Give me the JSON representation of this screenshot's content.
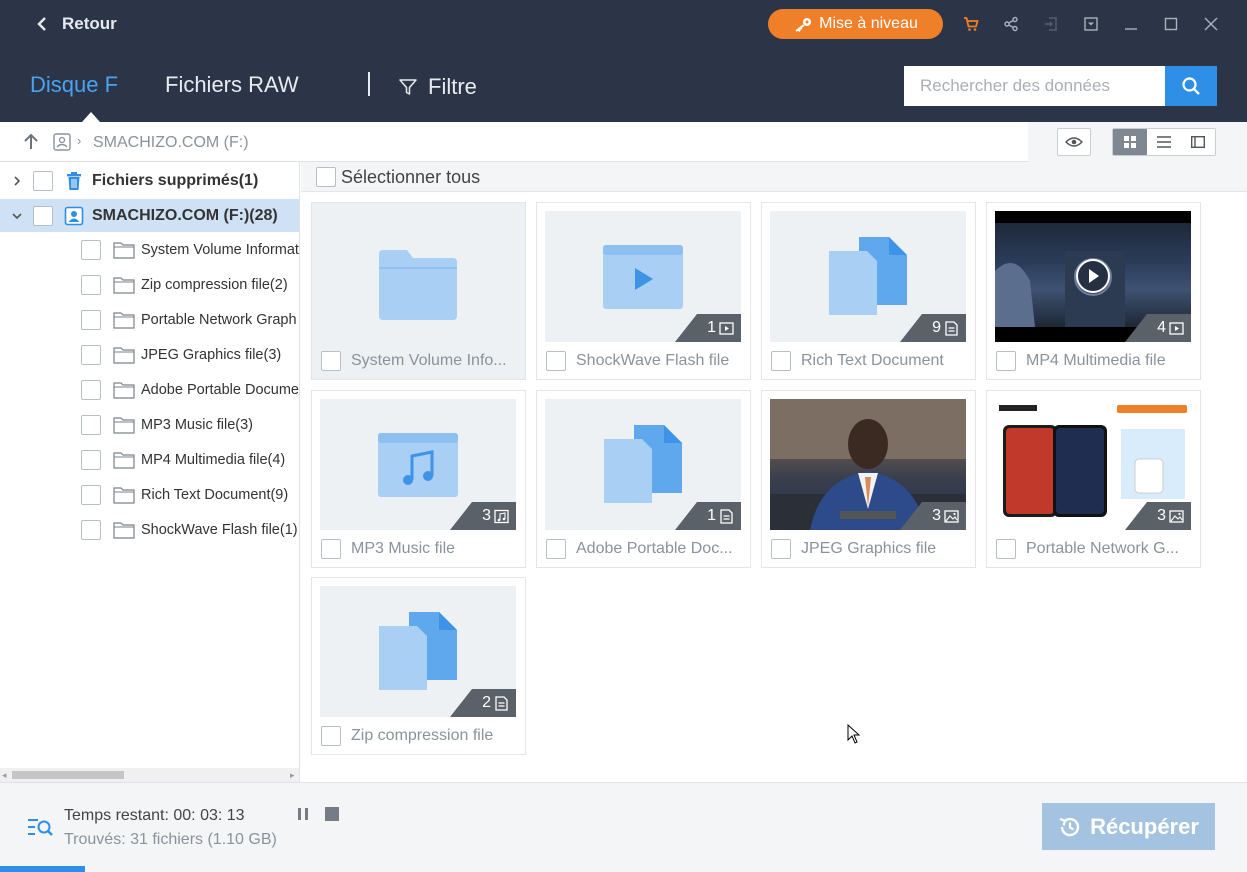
{
  "titlebar": {
    "back_label": "Retour",
    "upgrade_label": "Mise à niveau"
  },
  "nav": {
    "tabs": [
      {
        "label": "Disque F",
        "active": true
      },
      {
        "label": "Fichiers RAW",
        "active": false
      }
    ],
    "filter_label": "Filtre",
    "search_placeholder": "Rechercher des données"
  },
  "path": {
    "location": "SMACHIZO.COM (F:)"
  },
  "sidebar": {
    "roots": [
      {
        "label": "Fichiers supprimés(1)",
        "expanded": false,
        "icon": "trash-icon"
      },
      {
        "label": "SMACHIZO.COM (F:)(28)",
        "expanded": true,
        "icon": "drive-icon"
      }
    ],
    "children": [
      {
        "label": "System Volume Informat"
      },
      {
        "label": "Zip compression file(2)"
      },
      {
        "label": "Portable Network Graph"
      },
      {
        "label": "JPEG Graphics file(3)"
      },
      {
        "label": "Adobe Portable Docume"
      },
      {
        "label": "MP3 Music file(3)"
      },
      {
        "label": "MP4 Multimedia file(4)"
      },
      {
        "label": "Rich Text Document(9)"
      },
      {
        "label": "ShockWave Flash file(1)"
      }
    ]
  },
  "content": {
    "select_all_label": "Sélectionner tous",
    "cards": [
      {
        "label": "System Volume Info...",
        "count": "",
        "kind": "folder"
      },
      {
        "label": "ShockWave Flash file",
        "count": "1",
        "kind": "video-doc",
        "badge_icon": "video-icon"
      },
      {
        "label": "Rich Text Document",
        "count": "9",
        "kind": "doc",
        "badge_icon": "document-icon"
      },
      {
        "label": "MP4 Multimedia file",
        "count": "4",
        "kind": "video-photo",
        "badge_icon": "video-icon"
      },
      {
        "label": "MP3 Music file",
        "count": "3",
        "kind": "music",
        "badge_icon": "music-icon"
      },
      {
        "label": "Adobe Portable Doc...",
        "count": "1",
        "kind": "doc",
        "badge_icon": "document-icon"
      },
      {
        "label": "JPEG Graphics file",
        "count": "3",
        "kind": "portrait-photo",
        "badge_icon": "image-icon"
      },
      {
        "label": "Portable Network G...",
        "count": "3",
        "kind": "phone-photo",
        "badge_icon": "image-icon"
      },
      {
        "label": "Zip compression file",
        "count": "2",
        "kind": "doc",
        "badge_icon": "document-icon"
      }
    ]
  },
  "status": {
    "time_remaining": "Temps restant: 00: 03: 13",
    "found": "Trouvés: 31 fichiers (1.10 GB)",
    "recover_label": "Récupérer"
  },
  "colors": {
    "header_bg": "#2b3547",
    "accent": "#2f8ee6",
    "upgrade": "#f07f2a",
    "recover_disabled": "#a3c3e0"
  }
}
